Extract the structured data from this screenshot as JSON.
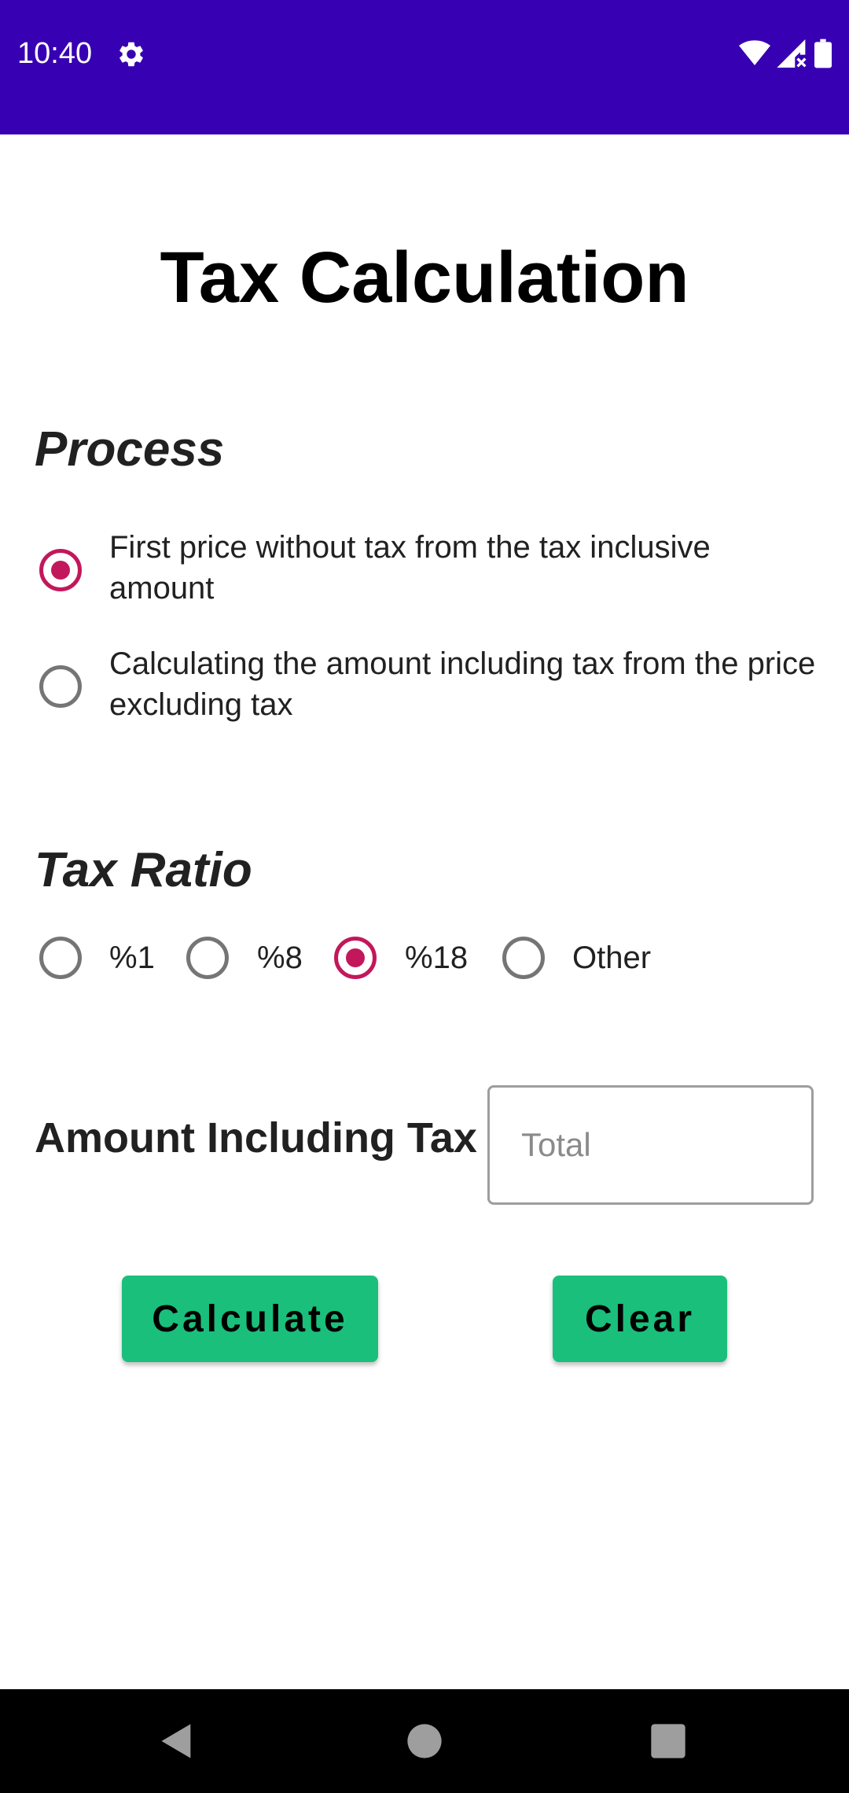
{
  "status_bar": {
    "time": "10:40",
    "icons": [
      "gear-icon",
      "wifi-icon",
      "signal-icon",
      "battery-icon"
    ],
    "background_color": "#3700b3"
  },
  "title": "Tax Calculation",
  "process": {
    "heading": "Process",
    "options": [
      {
        "label": "First price without tax from the tax inclusive amount",
        "checked": true
      },
      {
        "label": "Calculating the amount including tax from the price excluding tax",
        "checked": false
      }
    ]
  },
  "tax_ratio": {
    "heading": "Tax Ratio",
    "options": [
      {
        "label": "%1",
        "checked": false
      },
      {
        "label": "%8",
        "checked": false
      },
      {
        "label": "%18",
        "checked": true
      },
      {
        "label": "Other",
        "checked": false
      }
    ]
  },
  "amount": {
    "label": "Amount Including Tax",
    "placeholder": "Total",
    "value": ""
  },
  "buttons": {
    "calculate": "Calculate",
    "clear": "Clear"
  },
  "colors": {
    "accent": "#c2185b",
    "button": "#1abf7c",
    "status_bar": "#3700b3"
  },
  "nav_bar": {
    "icons": [
      "back-icon",
      "home-icon",
      "recents-icon"
    ]
  }
}
